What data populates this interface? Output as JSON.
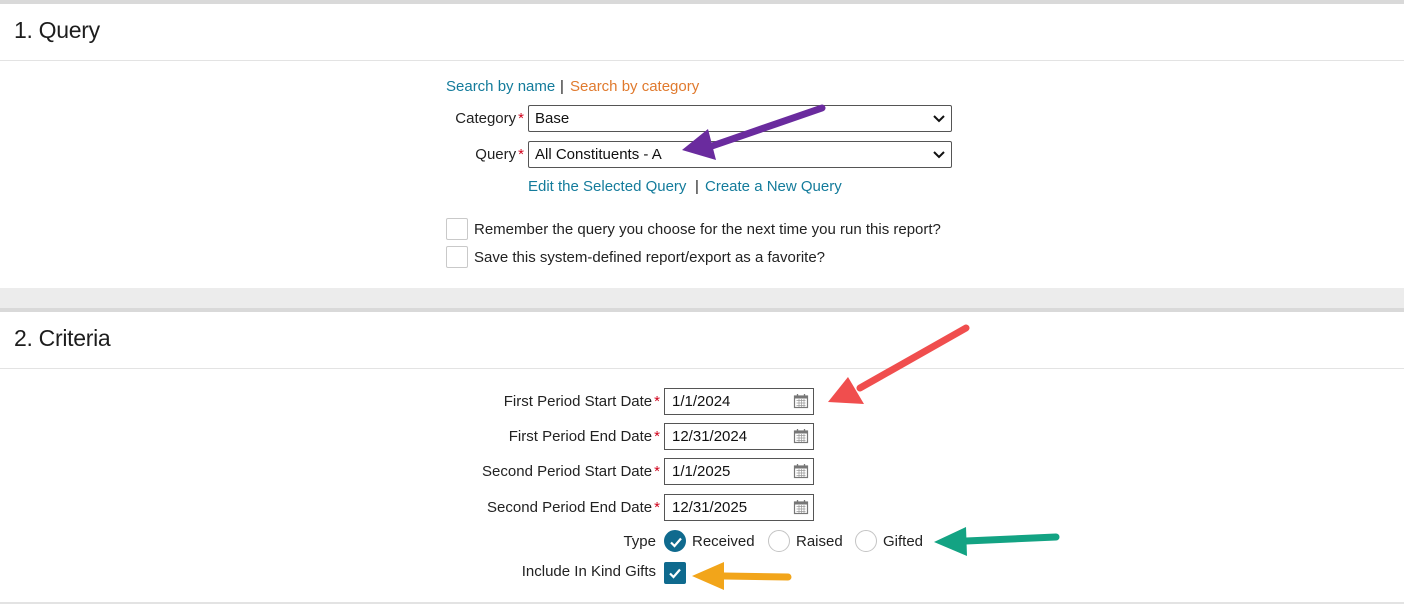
{
  "query_section": {
    "title": "1. Query",
    "search_by_name": "Search by name",
    "separator": "|",
    "search_by_category": "Search by category",
    "category_label": "Category",
    "category_value": "Base",
    "query_label": "Query",
    "query_value": "All Constituents - A",
    "edit_query": "Edit the Selected Query",
    "create_query": "Create a New Query",
    "remember_label": "Remember the query you choose for the next time you run this report?",
    "favorite_label": "Save this system-defined report/export as a favorite?",
    "required_mark": "*"
  },
  "criteria_section": {
    "title": "2. Criteria",
    "first_start_label": "First Period Start Date",
    "first_start_value": "1/1/2024",
    "first_end_label": "First Period End Date",
    "first_end_value": "12/31/2024",
    "second_start_label": "Second Period Start Date",
    "second_start_value": "1/1/2025",
    "second_end_label": "Second Period End Date",
    "second_end_value": "12/31/2025",
    "type_label": "Type",
    "type_options": [
      "Received",
      "Raised",
      "Gifted"
    ],
    "type_selected": "Received",
    "in_kind_label": "Include In Kind Gifts",
    "in_kind_checked": true
  },
  "annotation_colors": {
    "purple": "#6a2b9e",
    "red": "#f04e4e",
    "green": "#13a383",
    "orange": "#f2a51a"
  },
  "icons": [
    "chevron-down-icon",
    "calendar-icon",
    "checkmark-icon",
    "arrow-icon"
  ]
}
